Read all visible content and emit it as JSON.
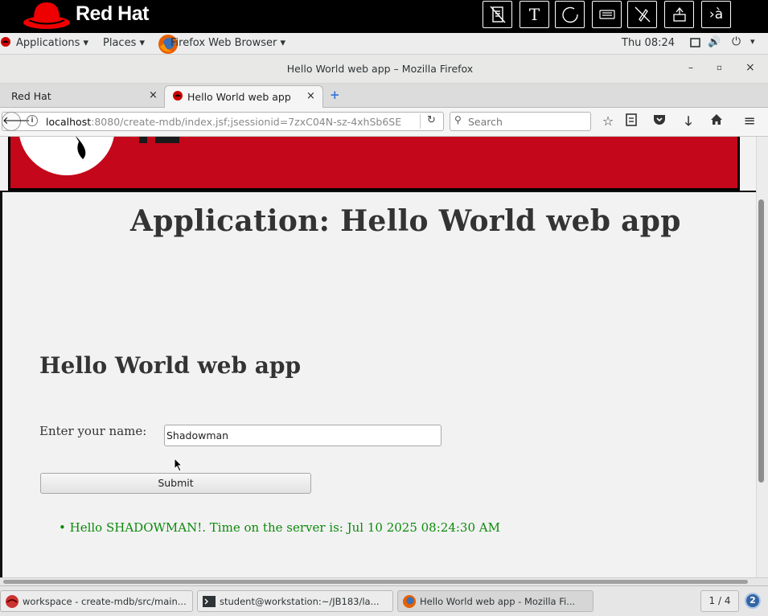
{
  "banner": {
    "brand": "Red Hat",
    "buttons": [
      "notes-icon",
      "text-icon",
      "circle-icon",
      "keyboard-icon",
      "no-pen-icon",
      "eject-icon"
    ],
    "lang_button": "›à"
  },
  "gnome_bar": {
    "applications": "Applications ▾",
    "places": "Places ▾",
    "firefox": "Firefox Web Browser ▾",
    "clock": "Thu 08:24"
  },
  "window": {
    "title": "Hello World web app – Mozilla Firefox",
    "minimize": "–",
    "maximize": "▫",
    "close": "×"
  },
  "tabs": [
    {
      "label": "Red Hat",
      "close": "×"
    },
    {
      "label": "Hello World web app",
      "close": "×"
    }
  ],
  "new_tab": "+",
  "navbar": {
    "url_host": "localhost",
    "url_rest": ":8080/create-mdb/index.jsf;jsessionid=7zxC04N-sz-4xhSb6SE",
    "search_placeholder": "Search"
  },
  "page": {
    "app_title": "Application: Hello World web app",
    "heading": "Hello World web app",
    "name_label": "Enter your name:",
    "name_value": "Shadowman",
    "submit_label": "Submit",
    "message": "Hello SHADOWMAN!. Time on the server is: Jul 10 2025 08:24:30 AM"
  },
  "taskbar": {
    "tasks": [
      "workspace - create-mdb/src/main...",
      "student@workstation:~/JB183/la...",
      "Hello World web app - Mozilla Fi..."
    ],
    "workspace_pager": "1 / 4",
    "notification_count": "2"
  }
}
